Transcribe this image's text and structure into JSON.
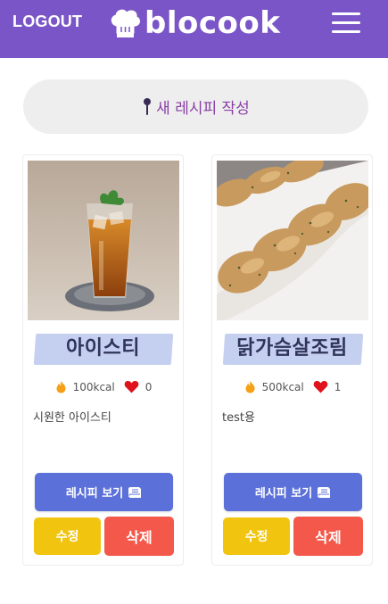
{
  "header": {
    "logout_label": "LOGOUT",
    "brand": "blocook",
    "brand_icon": "chef-hat-icon",
    "menu_icon": "hamburger-menu-icon",
    "color": "#7a55c8"
  },
  "new_recipe": {
    "icon": "pin-icon",
    "label": "새 레시피 작성"
  },
  "recipes": [
    {
      "title": "아이스티",
      "kcal": "100kcal",
      "likes": "0",
      "description": "시원한 아이스티",
      "image": "iced-tea-photo",
      "view_label": "레시피 보기",
      "edit_label": "수정",
      "delete_label": "삭제"
    },
    {
      "title": "닭가슴살조림",
      "kcal": "500kcal",
      "likes": "1",
      "description": "test용",
      "image": "braised-chicken-breast-photo",
      "view_label": "레시피 보기",
      "edit_label": "수정",
      "delete_label": "삭제"
    }
  ],
  "colors": {
    "view_button": "#5b70d8",
    "edit_button": "#f1c40f",
    "delete_button": "#f4584a",
    "title_highlight": "#c5cff0"
  }
}
